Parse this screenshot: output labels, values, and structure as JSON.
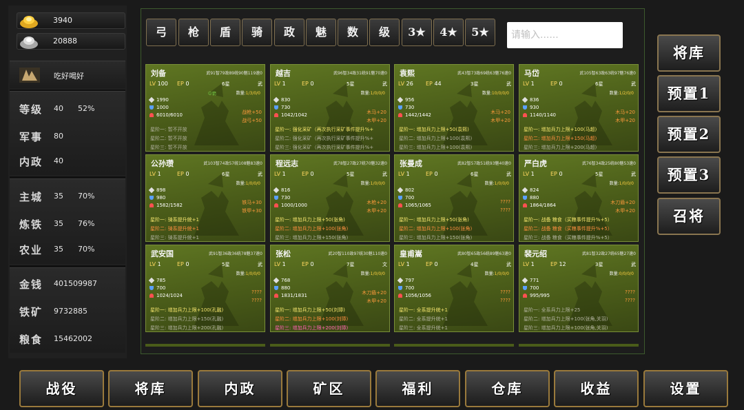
{
  "resources": {
    "gold_ingot": "3940",
    "silver_ingot": "20888"
  },
  "player": {
    "name": "吃好喝好"
  },
  "stats": [
    {
      "label": "等级",
      "value": "40",
      "extra": "52%"
    },
    {
      "label": "军事",
      "value": "80",
      "extra": ""
    },
    {
      "label": "内政",
      "value": "40",
      "extra": ""
    }
  ],
  "buildings": [
    {
      "label": "主城",
      "value": "35",
      "extra": "70%"
    },
    {
      "label": "炼铁",
      "value": "35",
      "extra": "76%"
    },
    {
      "label": "农业",
      "value": "35",
      "extra": "70%"
    }
  ],
  "materials": [
    {
      "label": "金钱",
      "value": "401509987"
    },
    {
      "label": "铁矿",
      "value": "9732885"
    },
    {
      "label": "粮食",
      "value": "15462002"
    }
  ],
  "filters": [
    "弓",
    "枪",
    "盾",
    "骑",
    "政",
    "魅",
    "数",
    "级",
    "3★",
    "4★",
    "5★"
  ],
  "search": {
    "placeholder": "请输入......"
  },
  "cards": [
    {
      "name": "刘备",
      "attrs": "武91智79政89统90魅119速0",
      "lv_tag": "LV",
      "lv": "100",
      "ep_tag": "EP",
      "ep": "0",
      "star": "6星",
      "type": "武",
      "qty_label": "数量:",
      "qty": "1/3/0/0",
      "status": "中箭",
      "s1": "1990",
      "s2": "1000",
      "s3": "6010/6010",
      "b1": "战枪+50",
      "b2": "战弓+50",
      "sk": [
        {
          "t": "星阶一:  暂不开放",
          "c": "dim"
        },
        {
          "t": "星阶二:  暂不开放",
          "c": "dim"
        },
        {
          "t": "星阶三:  暂不开放",
          "c": "dim"
        }
      ]
    },
    {
      "name": "越吉",
      "attrs": "武96智34政31统91魅70速0",
      "lv_tag": "LV",
      "lv": "1",
      "ep_tag": "EP",
      "ep": "0",
      "star": "5星",
      "type": "武",
      "qty_label": "数量:",
      "qty": "1/0/0/0",
      "status": "",
      "s1": "830",
      "s2": "730",
      "s3": "1042/1042",
      "b1": "木马+20",
      "b2": "木甲+20",
      "sk": [
        {
          "t": "星阶一:  强化采矿（再次执行采矿事件提升%+",
          "c": "yel"
        },
        {
          "t": "星阶二:  强化采矿（再次执行采矿事件提升%+",
          "c": "dim"
        },
        {
          "t": "星阶三:  强化采矿（再次执行采矿事件提升%+",
          "c": "dim"
        }
      ]
    },
    {
      "name": "袁熙",
      "attrs": "武43智73政69统63魅76速0",
      "lv_tag": "LV",
      "lv": "26",
      "ep_tag": "EP",
      "ep": "44",
      "star": "3星",
      "type": "武",
      "qty_label": "数量:",
      "qty": "10/0/0/0",
      "status": "",
      "s1": "956",
      "s2": "730",
      "s3": "1442/1442",
      "b1": "木马+20",
      "b2": "木甲+20",
      "sk": [
        {
          "t": "星阶一:  增加兵力上限+50(袁熙)",
          "c": "yel"
        },
        {
          "t": "星阶二:  增加兵力上限+100(袁熙)",
          "c": "dim"
        },
        {
          "t": "星阶三:  增加兵力上限+100(袁熙)",
          "c": "dim"
        }
      ]
    },
    {
      "name": "马岱",
      "attrs": "武105智63政63统97魅76速0",
      "lv_tag": "LV",
      "lv": "1",
      "ep_tag": "EP",
      "ep": "0",
      "star": "6星",
      "type": "武",
      "qty_label": "数量:",
      "qty": "1/2/0/0",
      "status": "",
      "s1": "836",
      "s2": "930",
      "s3": "1140/1140",
      "b1": "木马+20",
      "b2": "木甲+20",
      "sk": [
        {
          "t": "星阶一:  增加兵力上限+100(马超)",
          "c": "yel"
        },
        {
          "t": "星阶二:  增加兵力上限+150(马超)",
          "c": "org"
        },
        {
          "t": "星阶三:  增加兵力上限+200(马超)",
          "c": "dim"
        }
      ]
    },
    {
      "name": "公孙瓒",
      "attrs": "武103智74政57统108魅83速0",
      "lv_tag": "LV",
      "lv": "1",
      "ep_tag": "EP",
      "ep": "0",
      "star": "6星",
      "type": "武",
      "qty_label": "数量:",
      "qty": "1/0/0/0",
      "status": "",
      "s1": "898",
      "s2": "980",
      "s3": "1582/1582",
      "b1": "铁马+30",
      "b2": "铁甲+30",
      "sk": [
        {
          "t": "星阶一:  骑系提升统+1",
          "c": "yel"
        },
        {
          "t": "星阶二:  骑系提升统+1",
          "c": "org"
        },
        {
          "t": "星阶三:  骑系提升统+1",
          "c": "dim"
        }
      ]
    },
    {
      "name": "程远志",
      "attrs": "武78智27政27统70魅32速0",
      "lv_tag": "LV",
      "lv": "1",
      "ep_tag": "EP",
      "ep": "0",
      "star": "5星",
      "type": "武",
      "qty_label": "数量:",
      "qty": "1/0/0/0",
      "status": "",
      "s1": "816",
      "s2": "730",
      "s3": "1000/1000",
      "b1": "木枪+20",
      "b2": "木甲+20",
      "sk": [
        {
          "t": "星阶一:  增加兵力上限+50(张角)",
          "c": "yel"
        },
        {
          "t": "星阶二:  增加兵力上限+100(张角)",
          "c": "org"
        },
        {
          "t": "星阶三:  增加兵力上限+150(张角)",
          "c": "dim"
        }
      ]
    },
    {
      "name": "张曼成",
      "attrs": "武82智57政51统93魅40速0",
      "lv_tag": "LV",
      "lv": "1",
      "ep_tag": "EP",
      "ep": "0",
      "star": "6星",
      "type": "武",
      "qty_label": "数量:",
      "qty": "1/0/0/0",
      "status": "",
      "s1": "802",
      "s2": "700",
      "s3": "1065/1065",
      "b1": "????",
      "b2": "????",
      "sk": [
        {
          "t": "星阶一:  增加兵力上限+50(张角)",
          "c": "yel"
        },
        {
          "t": "星阶二:  增加兵力上限+100(张角)",
          "c": "org"
        },
        {
          "t": "星阶三:  增加兵力上限+150(张角)",
          "c": "dim"
        }
      ]
    },
    {
      "name": "严白虎",
      "attrs": "武76智34政25统80魅53速0",
      "lv_tag": "LV",
      "lv": "1",
      "ep_tag": "EP",
      "ep": "0",
      "star": "5星",
      "type": "武",
      "qty_label": "数量:",
      "qty": "1/0/0/0",
      "status": "",
      "s1": "824",
      "s2": "880",
      "s3": "1864/1864",
      "b1": "木刀盾+20",
      "b2": "木甲+20",
      "sk": [
        {
          "t": "星阶一:  战备 粮食（买粮事件提升%+5）",
          "c": "yel"
        },
        {
          "t": "星阶二:  战备 粮食（买粮事件提升%+5）",
          "c": "org"
        },
        {
          "t": "星阶三:  战备 粮食（买粮事件提升%+5）",
          "c": "dim"
        }
      ]
    },
    {
      "name": "武安国",
      "attrs": "武91智36政36统78魅37速0",
      "lv_tag": "LV",
      "lv": "1",
      "ep_tag": "EP",
      "ep": "0",
      "star": "5星",
      "type": "武",
      "qty_label": "数量:",
      "qty": "1/0/0/0",
      "status": "",
      "s1": "785",
      "s2": "700",
      "s3": "1024/1024",
      "b1": "????",
      "b2": "????",
      "sk": [
        {
          "t": "星阶一:  增加兵力上限+100(孔融)",
          "c": "yel"
        },
        {
          "t": "星阶二:  增加兵力上限+150(孔融)",
          "c": "dim"
        },
        {
          "t": "星阶三:  增加兵力上限+200(孔融)",
          "c": "dim"
        }
      ]
    },
    {
      "name": "张松",
      "attrs": "武20智110政97统30魅110速0",
      "lv_tag": "LV",
      "lv": "1",
      "ep_tag": "EP",
      "ep": "0",
      "star": "7星",
      "type": "文",
      "qty_label": "数量:",
      "qty": "1/0/0/0",
      "status": "",
      "s1": "768",
      "s2": "880",
      "s3": "1831/1831",
      "b1": "木刀盾+20",
      "b2": "木甲+20",
      "sk": [
        {
          "t": "星阶一:  增加兵力上限+50(刘璋)",
          "c": "yel"
        },
        {
          "t": "星阶二:  增加兵力上限+100(刘璋)",
          "c": "org"
        },
        {
          "t": "星阶三:  增加兵力上限+200(刘璋)",
          "c": "pnk"
        }
      ]
    },
    {
      "name": "皇甫嵩",
      "attrs": "武80智65政56统89魅63速0",
      "lv_tag": "LV",
      "lv": "1",
      "ep_tag": "EP",
      "ep": "0",
      "star": "4星",
      "type": "武",
      "qty_label": "数量:",
      "qty": "1/0/0/0",
      "status": "",
      "s1": "797",
      "s2": "700",
      "s3": "1056/1056",
      "b1": "????",
      "b2": "????",
      "sk": [
        {
          "t": "星阶一:  全系提升统+1",
          "c": "yel"
        },
        {
          "t": "星阶二:  全系提升统+1",
          "c": "dim"
        },
        {
          "t": "星阶三:  全系提升统+1",
          "c": "dim"
        }
      ]
    },
    {
      "name": "裴元绍",
      "attrs": "武81智32政27统65魅27速0",
      "lv_tag": "LV",
      "lv": "1",
      "ep_tag": "EP",
      "ep": "12",
      "star": "3星",
      "type": "武",
      "qty_label": "数量:",
      "qty": "0/0/0/0",
      "status": "",
      "s1": "771",
      "s2": "700",
      "s3": "995/995",
      "b1": "????",
      "b2": "????",
      "sk": [
        {
          "t": "星阶一:  全系兵力上限+25",
          "c": "dim"
        },
        {
          "t": "星阶二:  增加兵力上限+100(张角,关羽)",
          "c": "dim"
        },
        {
          "t": "星阶三:  增加兵力上限+100(张角,关羽)",
          "c": "dim"
        }
      ]
    }
  ],
  "side_buttons": [
    "将库",
    "预置1",
    "预置2",
    "预置3",
    "召将"
  ],
  "nav": [
    "战役",
    "将库",
    "内政",
    "矿区",
    "福利",
    "仓库",
    "收益",
    "设置"
  ],
  "colors": {
    "card_green": "#5f7622",
    "button_border": "#9a7a3c",
    "skill_yellow": "#f6e66e",
    "skill_orange": "#ff9040",
    "skill_pink": "#ff60b4"
  }
}
